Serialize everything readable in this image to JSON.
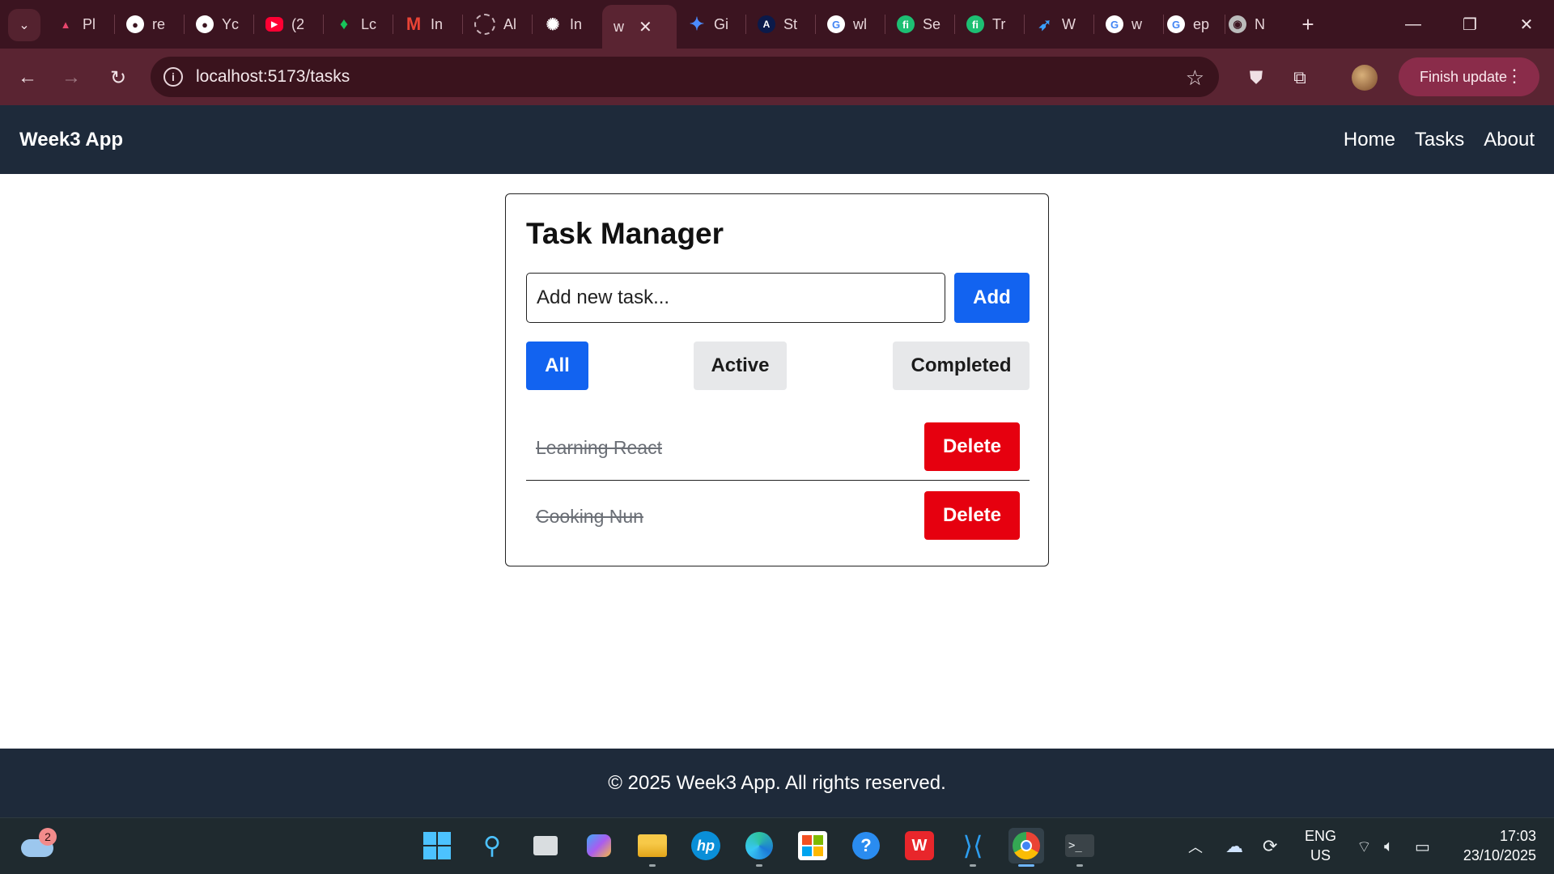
{
  "browser": {
    "tabs": [
      {
        "label": "Pl",
        "icon": "prisma-icon",
        "color": "#e8466d"
      },
      {
        "label": "re",
        "icon": "github-icon",
        "color": "#ffffff"
      },
      {
        "label": "Yc",
        "icon": "github-icon",
        "color": "#ffffff"
      },
      {
        "label": "(2",
        "icon": "youtube-icon",
        "color": "#ff0033"
      },
      {
        "label": "Lc",
        "icon": "mongodb-leaf-icon",
        "color": "#17c45a"
      },
      {
        "label": "In",
        "icon": "gmail-icon",
        "color": "#ea4335"
      },
      {
        "label": "Al",
        "icon": "loading-circle-icon",
        "color": "#c9b3b9"
      },
      {
        "label": "In",
        "icon": "openai-icon",
        "color": "#ffffff"
      },
      {
        "label": "w",
        "icon": "",
        "color": "#ffffff",
        "active": true
      },
      {
        "label": "Gi",
        "icon": "gemini-icon",
        "color": "#4b8bff"
      },
      {
        "label": "St",
        "icon": "angular-icon",
        "color": "#ffffff"
      },
      {
        "label": "wl",
        "icon": "google-icon",
        "color": "#ffffff"
      },
      {
        "label": "Se",
        "icon": "fiverr-icon",
        "color": "#1dbf73"
      },
      {
        "label": "Tr",
        "icon": "fiverr-icon",
        "color": "#1dbf73"
      },
      {
        "label": "W",
        "icon": "bird-icon",
        "color": "#3aa0ff"
      },
      {
        "label": "w",
        "icon": "google-icon",
        "color": "#ffffff"
      },
      {
        "label": "ep",
        "icon": "google-icon",
        "color": "#ffffff"
      },
      {
        "label": "N",
        "icon": "chrome-icon",
        "color": "#ffffff"
      }
    ],
    "url": "localhost:5173/tasks",
    "finish_update_label": "Finish update"
  },
  "app": {
    "brand": "Week3 App",
    "nav": [
      "Home",
      "Tasks",
      "About"
    ],
    "title": "Task Manager",
    "input_placeholder": "Add new task...",
    "add_label": "Add",
    "filters": {
      "all": "All",
      "active": "Active",
      "completed": "Completed",
      "selected": "All"
    },
    "tasks": [
      {
        "text": "Learning React",
        "completed": true,
        "delete_label": "Delete"
      },
      {
        "text": "Cooking Nun",
        "completed": true,
        "delete_label": "Delete"
      }
    ],
    "footer": "© 2025 Week3 App. All rights reserved."
  },
  "taskbar": {
    "weather_badge": "2",
    "lang_top": "ENG",
    "lang_bottom": "US",
    "time": "17:03",
    "date": "23/10/2025"
  },
  "colors": {
    "primary": "#1263f0",
    "danger": "#e6000f",
    "header_bg": "#1e2a3a",
    "browser_frame": "#3b1420"
  }
}
